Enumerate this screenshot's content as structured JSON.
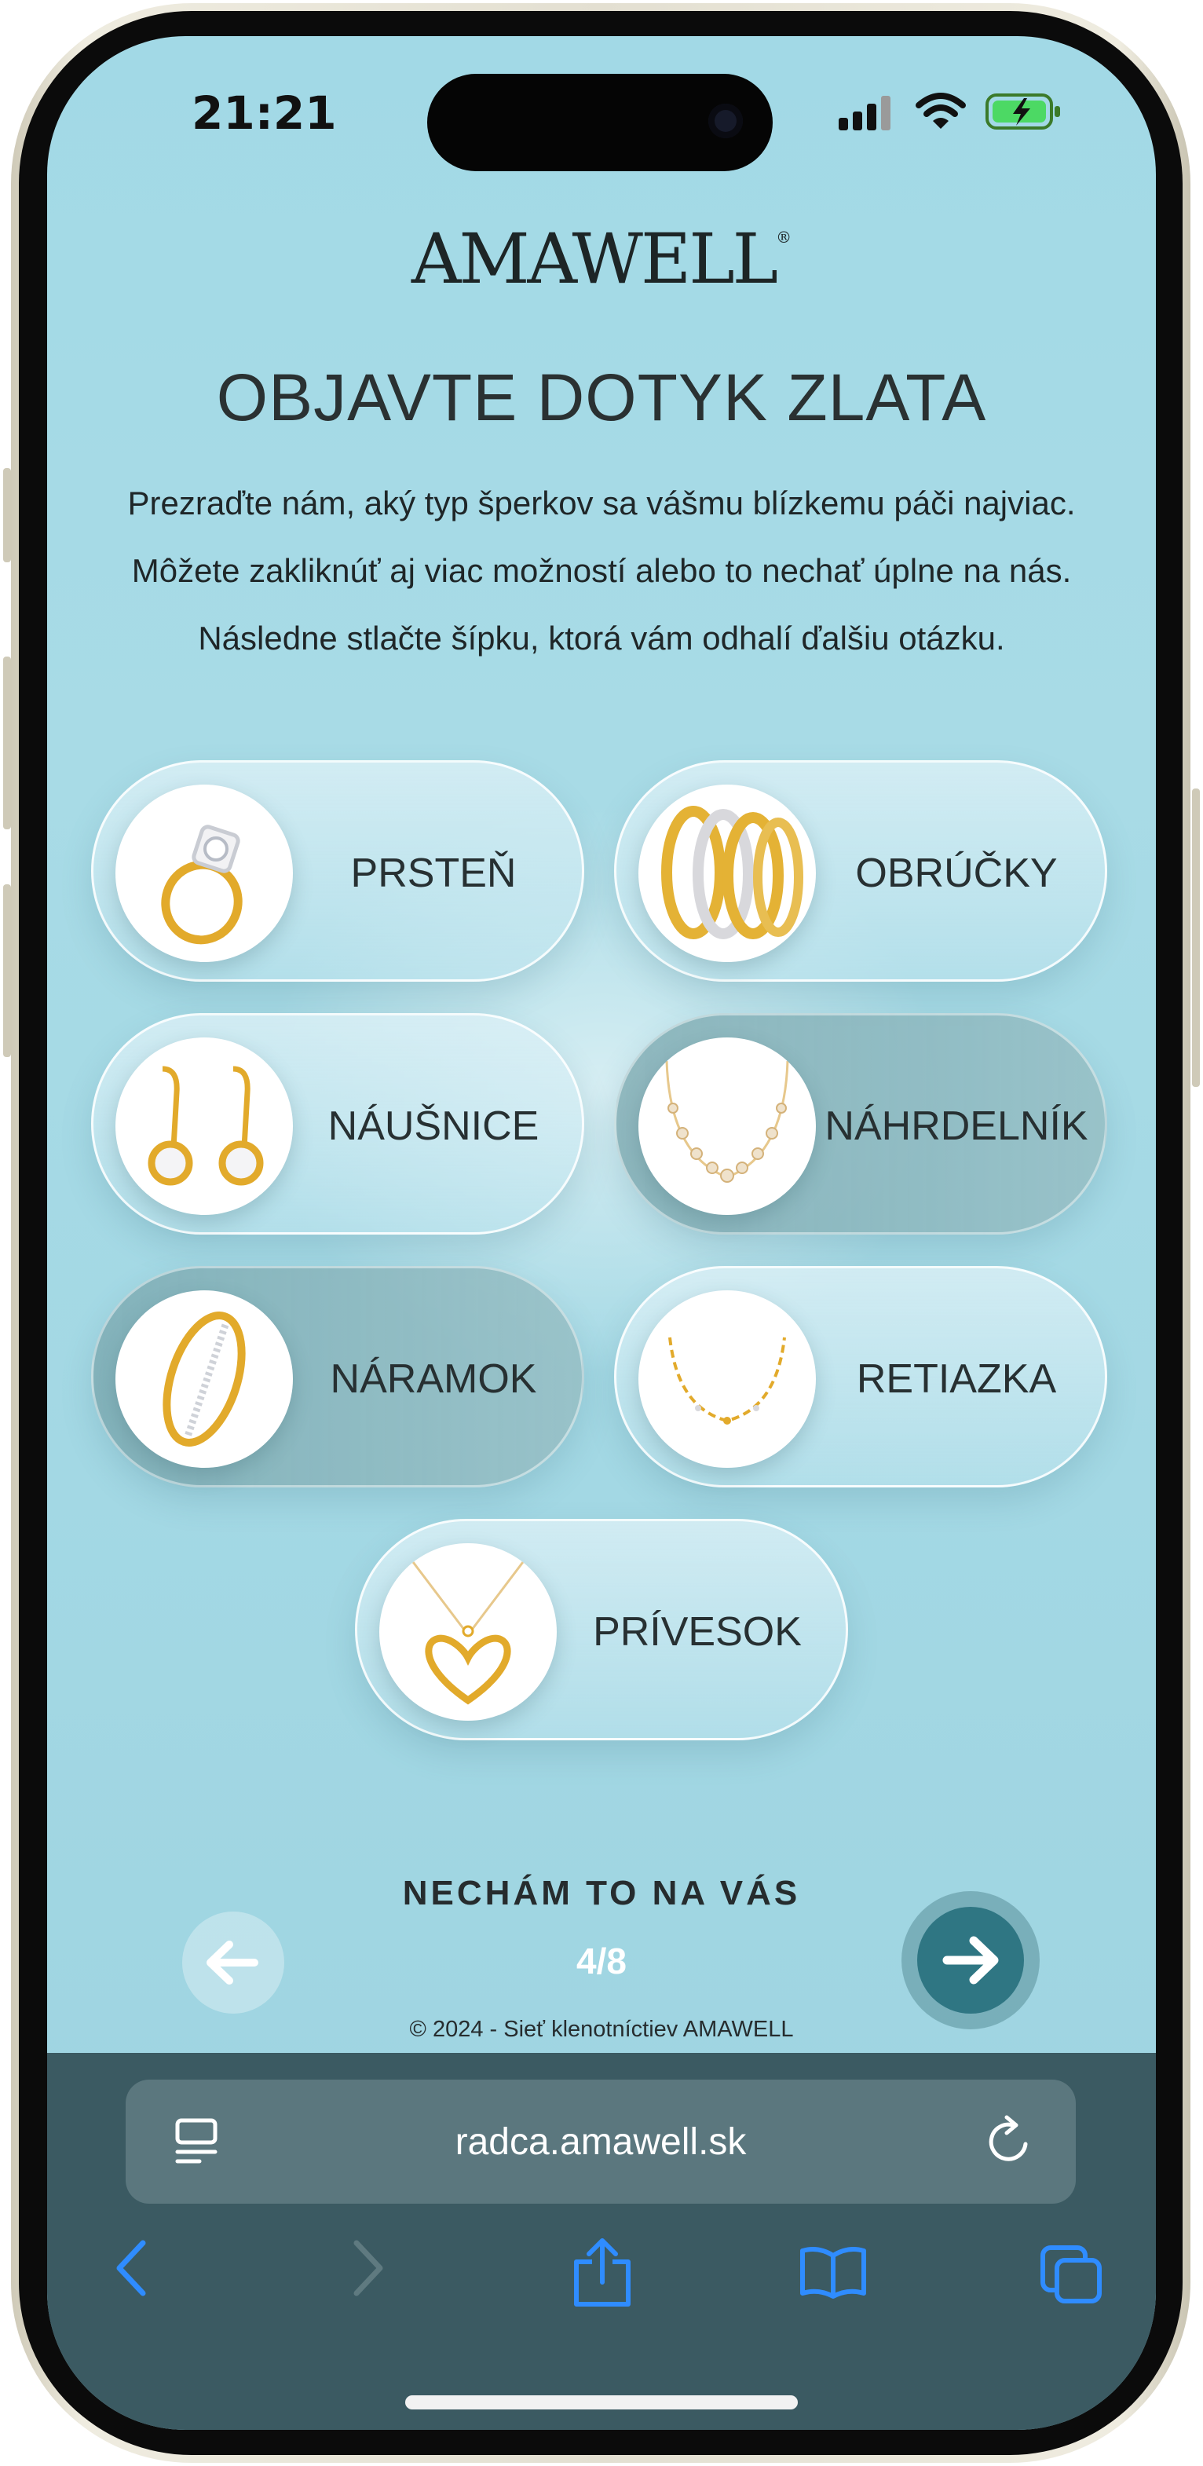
{
  "status_bar": {
    "time": "21:21"
  },
  "header": {
    "brand": "AMAWELL",
    "brand_mark": "®",
    "title": "OBJAVTE DOTYK ZLATA",
    "intro": "Prezraďte nám, aký typ šperkov sa vášmu blízkemu páči najviac. Môžete zakliknúť aj viac možností alebo to nechať úplne na nás. Následne stlačte šípku, ktorá vám odhalí ďalšiu otázku."
  },
  "options": [
    {
      "label": "PRSTEŇ",
      "icon": "ring-icon",
      "selected": false
    },
    {
      "label": "OBRÚČKY",
      "icon": "wedding-bands-icon",
      "selected": false
    },
    {
      "label": "NÁUŠNICE",
      "icon": "earrings-icon",
      "selected": false
    },
    {
      "label": "NÁHRDELNÍK",
      "icon": "necklace-icon",
      "selected": true
    },
    {
      "label": "NÁRAMOK",
      "icon": "bracelet-icon",
      "selected": true
    },
    {
      "label": "RETIAZKA",
      "icon": "chain-icon",
      "selected": false
    },
    {
      "label": "PRÍVESOK",
      "icon": "heart-pendant-icon",
      "selected": false
    }
  ],
  "actions": {
    "leave_it_to_you": "NECHÁM TO NA VÁS",
    "progress": "4/8",
    "prev_icon": "arrow-left-icon",
    "next_icon": "arrow-right-icon"
  },
  "footer": {
    "copyright": "© 2024 - Sieť klenotníctiev AMAWELL"
  },
  "browser": {
    "url": "radca.amawell.sk",
    "toolbar": [
      "back-icon",
      "forward-icon",
      "share-icon",
      "bookmarks-icon",
      "tabs-icon"
    ]
  },
  "colors": {
    "background": "#a2d9e6",
    "accent": "#2f7683",
    "browser_bar": "#3b5a62",
    "text_dark": "#273032",
    "gold": "#e0a92a"
  }
}
